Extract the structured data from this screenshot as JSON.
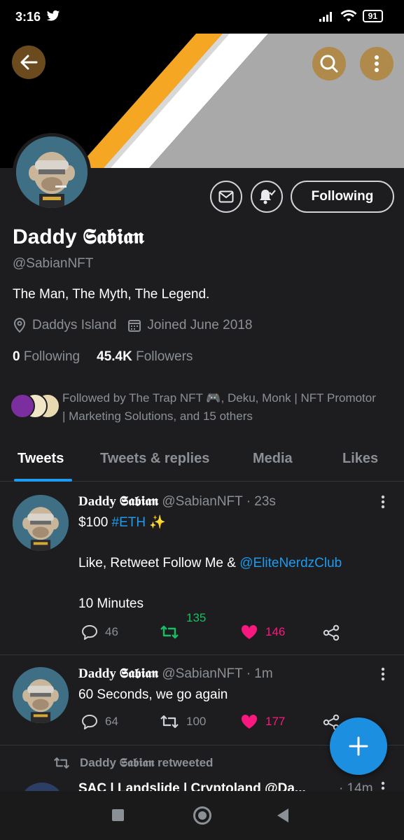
{
  "status_bar": {
    "time": "3:16",
    "battery": "91"
  },
  "profile": {
    "display_name_prefix": "Daddy ",
    "display_name_gothic": "𝕾𝖆𝖇𝖎𝖆𝖓",
    "handle": "@SabianNFT",
    "bio": "The Man, The Myth, The Legend.",
    "location": "Daddys Island",
    "joined": "Joined June 2018",
    "following_count": "0",
    "following_label": "Following",
    "followers_count": "45.4K",
    "followers_label": "Followers",
    "follow_button": "Following",
    "followed_by": "Followed by The Trap NFT 🎮, Deku, Monk | NFT Promotor | Marketing Solutions, and 15 others"
  },
  "colors": {
    "accent": "#1d9bf0",
    "retweet": "#17bf63",
    "like": "#f91880",
    "banner_orange": "#f5a623"
  },
  "tabs": [
    {
      "label": "Tweets",
      "active": true
    },
    {
      "label": "Tweets & replies",
      "active": false
    },
    {
      "label": "Media",
      "active": false
    },
    {
      "label": "Likes",
      "active": false
    }
  ],
  "tweets": [
    {
      "name": "Daddy 𝕾𝖆𝖇𝖎𝖆𝖓",
      "handle_time": "@SabianNFT · 23s",
      "line1_pre": "$100 ",
      "line1_tag": "#ETH",
      "line1_emoji": " ✨",
      "line2_pre": "Like, Retweet Follow Me & ",
      "line2_mention": "@EliteNerdzClub",
      "line3": "10 Minutes",
      "replies": "46",
      "retweets": "135",
      "likes": "146"
    },
    {
      "name": "Daddy 𝕾𝖆𝖇𝖎𝖆𝖓",
      "handle_time": "@SabianNFT · 1m",
      "text": "60 Seconds, we go again",
      "replies": "64",
      "retweets": "100",
      "likes": "177"
    }
  ],
  "retweeted_label": "Daddy 𝕾𝖆𝖇𝖎𝖆𝖓 retweeted",
  "next_tweet_head": "SAC | Landslide | Cryptoland @Da...",
  "next_tweet_time": "· 14m"
}
